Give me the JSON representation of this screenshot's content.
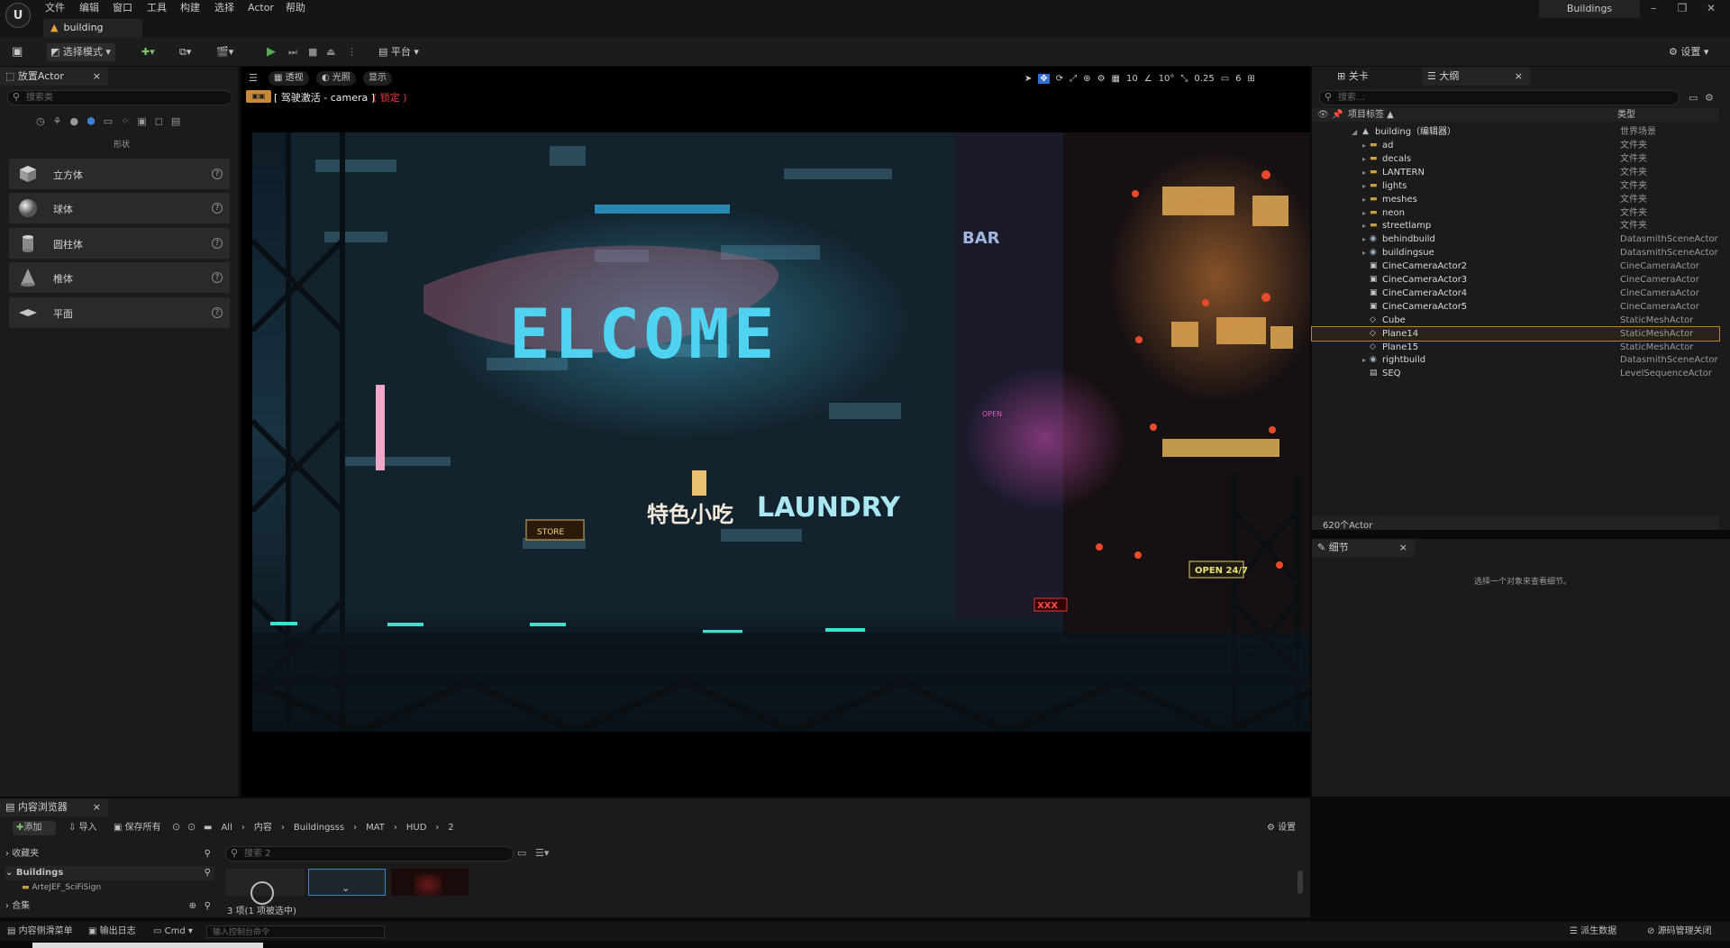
{
  "menu": {
    "items": [
      "文件",
      "编辑",
      "窗口",
      "工具",
      "构建",
      "选择",
      "Actor",
      "帮助"
    ],
    "project_name": "Buildings",
    "level_tab": "building"
  },
  "toolbar": {
    "select_mode": "选择模式",
    "platform": "平台",
    "settings": "设置"
  },
  "place_actor": {
    "tab": "放置Actor",
    "search_placeholder": "搜索类",
    "category": "形状",
    "shapes": [
      "立方体",
      "球体",
      "圆柱体",
      "椎体",
      "平面"
    ]
  },
  "viewport": {
    "perspective": "透视",
    "lit": "光照",
    "show": "显示",
    "pilot_text": "[ 驾驶激活 - camera ]",
    "pilot_locked": "( 锁定 )",
    "grid_snap": "10",
    "rot_snap": "10°",
    "scale_snap": "0.25",
    "cam_speed": "6",
    "scene_signs": {
      "welcome": "ELCOME",
      "laundry": "LAUNDRY",
      "food": "特色小吃",
      "bar": "BAR",
      "open": "OPEN 24/7",
      "open_small": "OPEN",
      "xxx": "XXX",
      "store": "STORE"
    },
    "colors": {
      "neon_cyan": "#3fc7e8",
      "neon_pink": "#e05ab8",
      "lantern": "#e04a30"
    }
  },
  "outliner": {
    "tab_level": "关卡",
    "tab_outliner": "大纲",
    "search_placeholder": "搜索...",
    "col_label": "项目标签 ▲",
    "col_type": "类型",
    "root": {
      "name": "building（编辑器）",
      "type": "世界场景"
    },
    "items": [
      {
        "name": "ad",
        "type": "文件夹",
        "icon": "folder"
      },
      {
        "name": "decals",
        "type": "文件夹",
        "icon": "folder"
      },
      {
        "name": "LANTERN",
        "type": "文件夹",
        "icon": "folder"
      },
      {
        "name": "lights",
        "type": "文件夹",
        "icon": "folder"
      },
      {
        "name": "meshes",
        "type": "文件夹",
        "icon": "folder"
      },
      {
        "name": "neon",
        "type": "文件夹",
        "icon": "folder"
      },
      {
        "name": "streetlamp",
        "type": "文件夹",
        "icon": "folder"
      },
      {
        "name": "behindbuild",
        "type": "DatasmithSceneActor",
        "icon": "actor"
      },
      {
        "name": "buildingsue",
        "type": "DatasmithSceneActor",
        "icon": "actor"
      },
      {
        "name": "CineCameraActor2",
        "type": "CineCameraActor",
        "icon": "camera"
      },
      {
        "name": "CineCameraActor3",
        "type": "CineCameraActor",
        "icon": "camera"
      },
      {
        "name": "CineCameraActor4",
        "type": "CineCameraActor",
        "icon": "camera"
      },
      {
        "name": "CineCameraActor5",
        "type": "CineCameraActor",
        "icon": "camera"
      },
      {
        "name": "Cube",
        "type": "StaticMeshActor",
        "icon": "mesh"
      },
      {
        "name": "Plane14",
        "type": "StaticMeshActor",
        "icon": "mesh",
        "selected": true
      },
      {
        "name": "Plane15",
        "type": "StaticMeshActor",
        "icon": "mesh"
      },
      {
        "name": "rightbuild",
        "type": "DatasmithSceneActor",
        "icon": "actor"
      },
      {
        "name": "SEQ",
        "type": "LevelSequenceActor",
        "icon": "sequence"
      }
    ],
    "count": "620个Actor"
  },
  "details": {
    "tab": "细节",
    "empty_text": "选择一个对象来查看细节。"
  },
  "content_browser": {
    "tab": "内容浏览器",
    "add": "添加",
    "import": "导入",
    "save_all": "保存所有",
    "breadcrumb": [
      "All",
      "内容",
      "Buildingsss",
      "MAT",
      "HUD",
      "2"
    ],
    "settings": "设置",
    "favorites": "收藏夹",
    "project": "Buildings",
    "folder": "ArteJEF_SciFiSign",
    "collections": "合集",
    "search_placeholder": "搜索 2",
    "status": "3 项(1 项被选中)"
  },
  "statusbar": {
    "drawer": "内容侧滑菜单",
    "output_log": "输出日志",
    "cmd": "Cmd",
    "console_placeholder": "输入控制台命令",
    "derived_data": "派生数据",
    "source_control": "源码管理关闭"
  }
}
